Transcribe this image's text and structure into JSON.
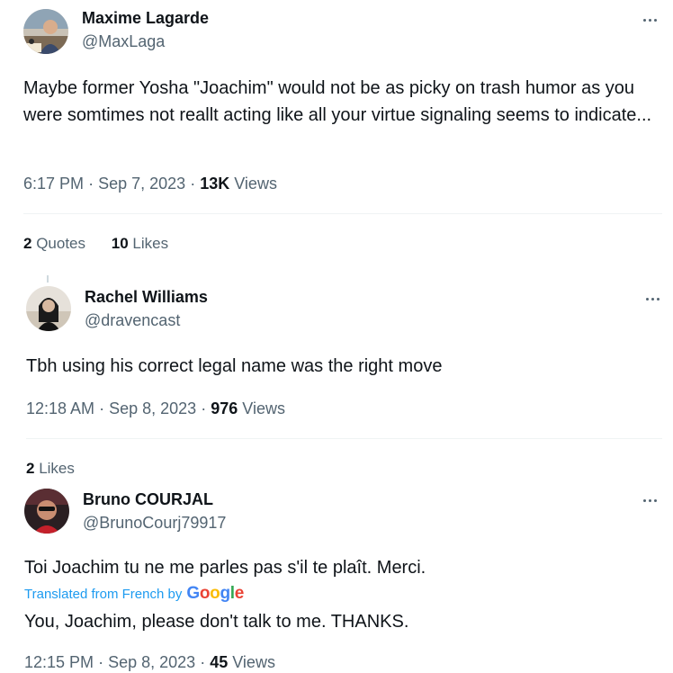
{
  "tweets": [
    {
      "display_name": "Maxime Lagarde",
      "handle": "@MaxLaga",
      "text": "Maybe former Yosha \"Joachim\" would not be as picky on trash humor as you were somtimes not reallt acting like all your virtue signaling seems to indicate...",
      "time": "6:17 PM",
      "date": "Sep 7, 2023",
      "views_count": "13K",
      "views_label": "Views",
      "quotes_count": "2",
      "quotes_label": "Quotes",
      "likes_count": "10",
      "likes_label": "Likes"
    },
    {
      "display_name": "Rachel Williams",
      "handle": "@dravencast",
      "text": "Tbh using his correct legal name was the right move",
      "time": "12:18 AM",
      "date": "Sep 8, 2023",
      "views_count": "976",
      "views_label": "Views",
      "likes_count": "2",
      "likes_label": "Likes"
    },
    {
      "display_name": "Bruno COURJAL",
      "handle": "@BrunoCourj79917",
      "text": "Toi Joachim tu ne me parles pas s'il te plaît. Merci.",
      "translated_label": "Translated from French by",
      "translated_provider": "Google",
      "translation": "You, Joachim, please don't talk to me. THANKS.",
      "time": "12:15 PM",
      "date": "Sep 8, 2023",
      "views_count": "45",
      "views_label": "Views"
    }
  ],
  "separator": "·",
  "colors": {
    "text_primary": "#0f1419",
    "text_secondary": "#536471",
    "link": "#1d9bf0",
    "divider": "#eff3f4"
  },
  "icons": {
    "more": "more-horizontal-icon"
  }
}
